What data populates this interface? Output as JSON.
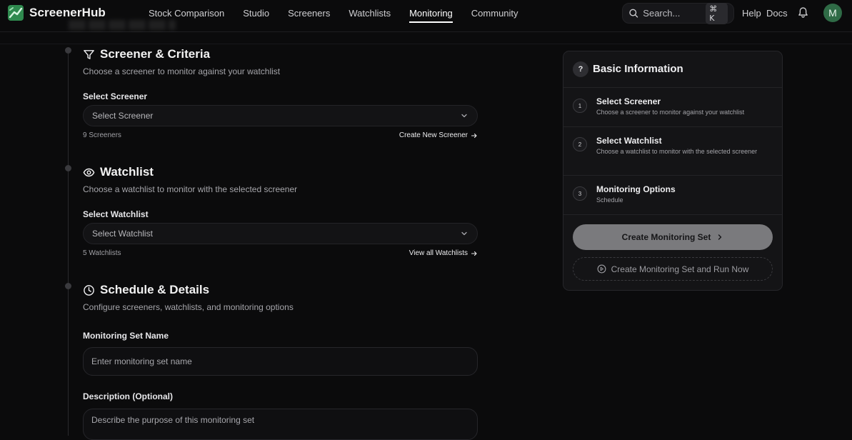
{
  "brand": {
    "name": "ScreenerHub",
    "logo_icon": "screenerhub-logo-icon",
    "accent": "#3a9a5c"
  },
  "nav": {
    "items": [
      {
        "label": "Stock Comparison",
        "active": false
      },
      {
        "label": "Studio",
        "active": false
      },
      {
        "label": "Screeners",
        "active": false
      },
      {
        "label": "Watchlists",
        "active": false
      },
      {
        "label": "Monitoring",
        "active": true
      },
      {
        "label": "Community",
        "active": false
      }
    ]
  },
  "search": {
    "placeholder": "Search...",
    "shortcut": "⌘ K",
    "icon": "search-icon"
  },
  "header_links": {
    "help": "Help",
    "docs": "Docs"
  },
  "notifications": {
    "icon": "bell-icon"
  },
  "user": {
    "avatar_initial": "M",
    "avatar_color": "#2f6b46"
  },
  "sections": {
    "screener": {
      "icon": "filter-icon",
      "title": "Screener & Criteria",
      "description": "Choose a screener to monitor against your watchlist",
      "label": "Select Screener",
      "select_value": "Select Screener",
      "count": "9 Screeners",
      "link": "Create New Screener"
    },
    "watchlist": {
      "icon": "eye-icon",
      "title": "Watchlist",
      "description": "Choose a watchlist to monitor with the selected screener",
      "label": "Select Watchlist",
      "select_value": "Select Watchlist",
      "count": "5 Watchlists",
      "link": "View all Watchlists"
    },
    "schedule": {
      "icon": "clock-icon",
      "title": "Schedule & Details",
      "description": "Configure screeners, watchlists, and monitoring options",
      "name_label": "Monitoring Set Name",
      "name_placeholder": "Enter monitoring set name",
      "desc_label": "Description (Optional)",
      "desc_placeholder": "Describe the purpose of this monitoring set"
    }
  },
  "panel": {
    "badge": "?",
    "title": "Basic Information",
    "steps": [
      {
        "num": "1",
        "title": "Select Screener",
        "desc": "Choose a screener to monitor against your watchlist"
      },
      {
        "num": "2",
        "title": "Select Watchlist",
        "desc": "Choose a watchlist to monitor with the selected screener"
      },
      {
        "num": "3",
        "title": "Monitoring Options",
        "desc": "Schedule"
      }
    ],
    "primary_button": "Create Monitoring Set",
    "secondary_button": "Create Monitoring Set and Run Now"
  }
}
